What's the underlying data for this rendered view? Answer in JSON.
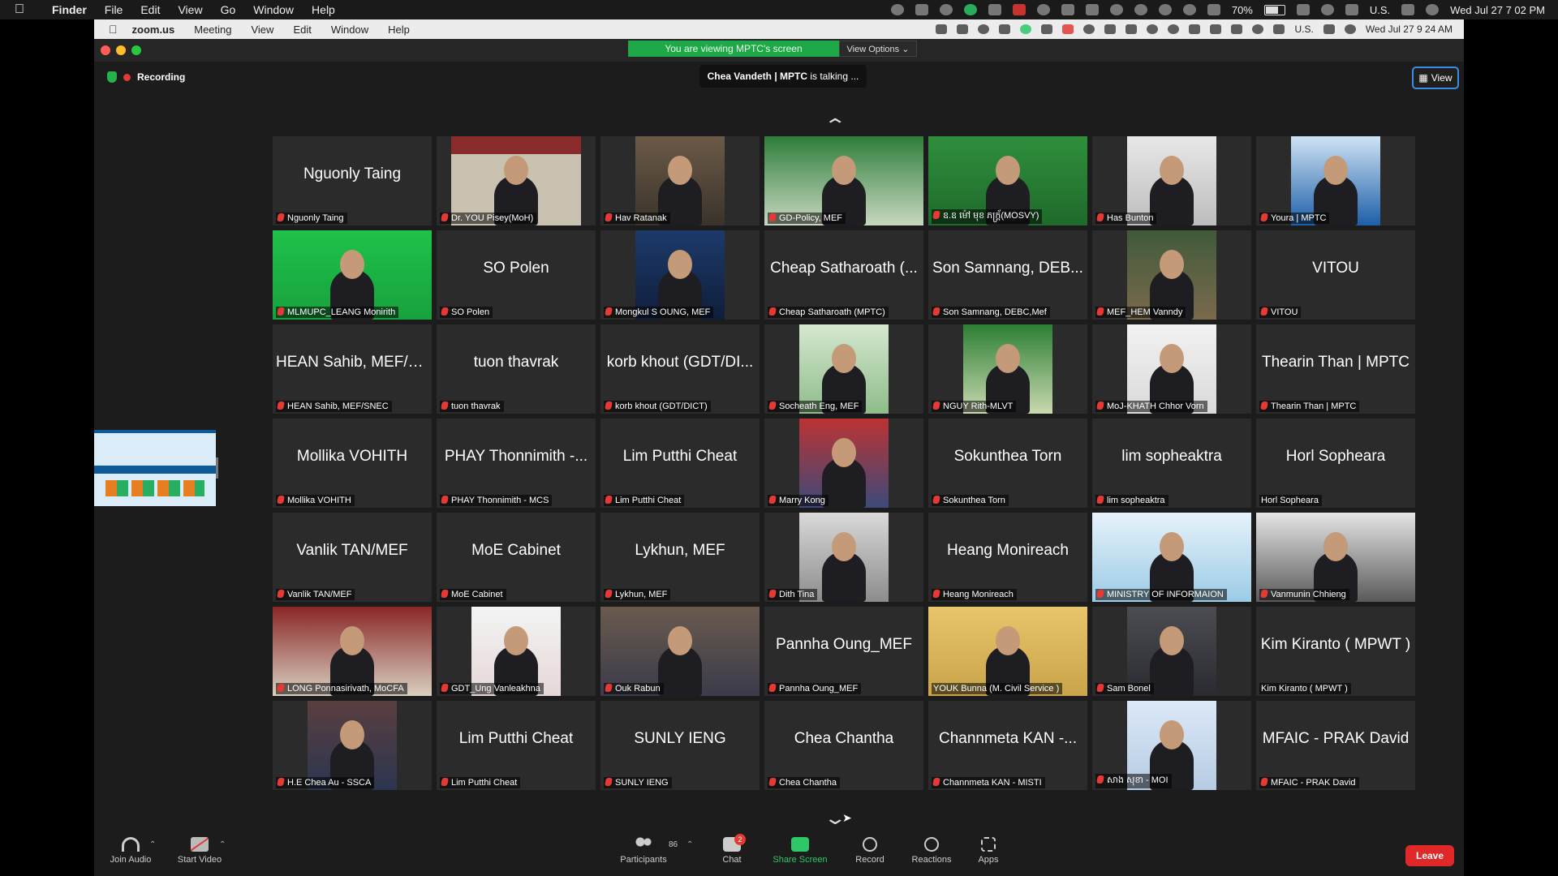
{
  "outer_menubar": {
    "app": "Finder",
    "items": [
      "File",
      "Edit",
      "View",
      "Go",
      "Window",
      "Help"
    ],
    "battery": "70%",
    "input_source": "U.S.",
    "clock": "Wed Jul 27  7 02 PM"
  },
  "inner_menubar": {
    "app": "zoom.us",
    "items": [
      "Meeting",
      "View",
      "Edit",
      "Window",
      "Help"
    ],
    "input_source": "U.S.",
    "clock": "Wed Jul 27  9 24 AM"
  },
  "meeting": {
    "viewing_banner": "You are viewing MPTC's screen",
    "view_options": "View Options ⌄",
    "recording": "Recording",
    "talking_prefix": "Chea Vandeth | MPTC",
    "talking_suffix": " is talking ...",
    "view_button": "View"
  },
  "participants": [
    {
      "name": "Nguonly Taing",
      "display": "Nguonly Taing",
      "muted": true
    },
    {
      "name": "Dr. YOU Pisey(MoH)",
      "display": "",
      "muted": true
    },
    {
      "name": "Hav Ratanak",
      "display": "",
      "muted": true
    },
    {
      "name": "GD-Policy, MEF",
      "display": "",
      "muted": true
    },
    {
      "name": "ឧ.ឧ ម៉ៅ មុខ ភក្ដ្រ័(MOSVY)",
      "display": "",
      "muted": true
    },
    {
      "name": "Has Bunton",
      "display": "",
      "muted": true
    },
    {
      "name": "Youra | MPTC",
      "display": "",
      "muted": true
    },
    {
      "name": "MLMUPC_LEANG Monirith",
      "display": "",
      "muted": true
    },
    {
      "name": "SO Polen",
      "display": "SO Polen",
      "muted": true
    },
    {
      "name": "Mongkul S OUNG, MEF",
      "display": "",
      "muted": true
    },
    {
      "name": "Cheap Satharoath (MPTC)",
      "display": "Cheap Satharoath (...",
      "muted": true
    },
    {
      "name": "Son Samnang, DEBC,Mef",
      "display": "Son Samnang, DEB...",
      "muted": true
    },
    {
      "name": "MEF_HEM Vanndy",
      "display": "",
      "muted": true
    },
    {
      "name": "VITOU",
      "display": "VITOU",
      "muted": true
    },
    {
      "name": "HEAN Sahib, MEF/SNEC",
      "display": "HEAN Sahib, MEF/S...",
      "muted": true
    },
    {
      "name": "tuon thavrak",
      "display": "tuon thavrak",
      "muted": true
    },
    {
      "name": "korb khout (GDT/DICT)",
      "display": "korb khout (GDT/DI...",
      "muted": true
    },
    {
      "name": "Socheath Eng, MEF",
      "display": "",
      "muted": true
    },
    {
      "name": "NGUY Rith-MLVT",
      "display": "",
      "muted": true
    },
    {
      "name": "MoJ-KHATH Chhor Vorn",
      "display": "",
      "muted": true
    },
    {
      "name": "Thearin Than | MPTC",
      "display": "Thearin Than | MPTC",
      "muted": true
    },
    {
      "name": "Mollika VOHITH",
      "display": "Mollika VOHITH",
      "muted": true
    },
    {
      "name": "PHAY Thonnimith - MCS",
      "display": "PHAY Thonnimith -...",
      "muted": true
    },
    {
      "name": "Lim Putthi Cheat",
      "display": "Lim Putthi Cheat",
      "muted": true
    },
    {
      "name": "Marry Kong",
      "display": "",
      "muted": true
    },
    {
      "name": "Sokunthea Torn",
      "display": "Sokunthea Torn",
      "muted": true
    },
    {
      "name": "lim sopheaktra",
      "display": "lim sopheaktra",
      "muted": true
    },
    {
      "name": "Horl Sopheara",
      "display": "Horl Sopheara",
      "muted": false
    },
    {
      "name": "Vanlik TAN/MEF",
      "display": "Vanlik TAN/MEF",
      "muted": true
    },
    {
      "name": "MoE Cabinet",
      "display": "MoE Cabinet",
      "muted": true
    },
    {
      "name": "Lykhun, MEF",
      "display": "Lykhun, MEF",
      "muted": true
    },
    {
      "name": "Dith Tina",
      "display": "",
      "muted": true
    },
    {
      "name": "Heang Monireach",
      "display": "Heang Monireach",
      "muted": true
    },
    {
      "name": "MINISTRY OF INFORMAION",
      "display": "",
      "muted": true
    },
    {
      "name": "Vanmunin Chhieng",
      "display": "",
      "muted": true
    },
    {
      "name": "LONG Ponnasirivath, MoCFA",
      "display": "",
      "muted": true
    },
    {
      "name": "GDT_Ung Vanleakhna",
      "display": "",
      "muted": true
    },
    {
      "name": "Ouk Rabun",
      "display": "",
      "muted": true
    },
    {
      "name": "Pannha Oung_MEF",
      "display": "Pannha Oung_MEF",
      "muted": true
    },
    {
      "name": "YOUK Bunna (M. Civil Service )",
      "display": "",
      "muted": false
    },
    {
      "name": "Sam Bonel",
      "display": "",
      "muted": true
    },
    {
      "name": "Kim Kiranto ( MPWT )",
      "display": "Kim Kiranto ( MPWT )",
      "muted": false
    },
    {
      "name": "H.E Chea Au - SSCA",
      "display": "",
      "muted": true
    },
    {
      "name": "Lim Putthi Cheat",
      "display": "Lim Putthi Cheat",
      "muted": true
    },
    {
      "name": "SUNLY IENG",
      "display": "SUNLY IENG",
      "muted": true
    },
    {
      "name": "Chea Chantha",
      "display": "Chea Chantha",
      "muted": true
    },
    {
      "name": "Channmeta KAN - MISTI",
      "display": "Channmeta KAN -...",
      "muted": true
    },
    {
      "name": "សាង សុខា - MOI",
      "display": "",
      "muted": true
    },
    {
      "name": "MFAIC - PRAK David",
      "display": "MFAIC - PRAK David",
      "muted": true
    }
  ],
  "toolbar": {
    "join_audio": "Join Audio",
    "start_video": "Start Video",
    "participants": "Participants",
    "participants_count": "86",
    "chat": "Chat",
    "chat_badge": "2",
    "share_screen": "Share Screen",
    "record": "Record",
    "reactions": "Reactions",
    "apps": "Apps",
    "leave": "Leave"
  },
  "colors": {
    "share_green": "#2ec866",
    "leave_red": "#e02828",
    "banner_green": "#1ea84a",
    "mic_red": "#e53935"
  }
}
